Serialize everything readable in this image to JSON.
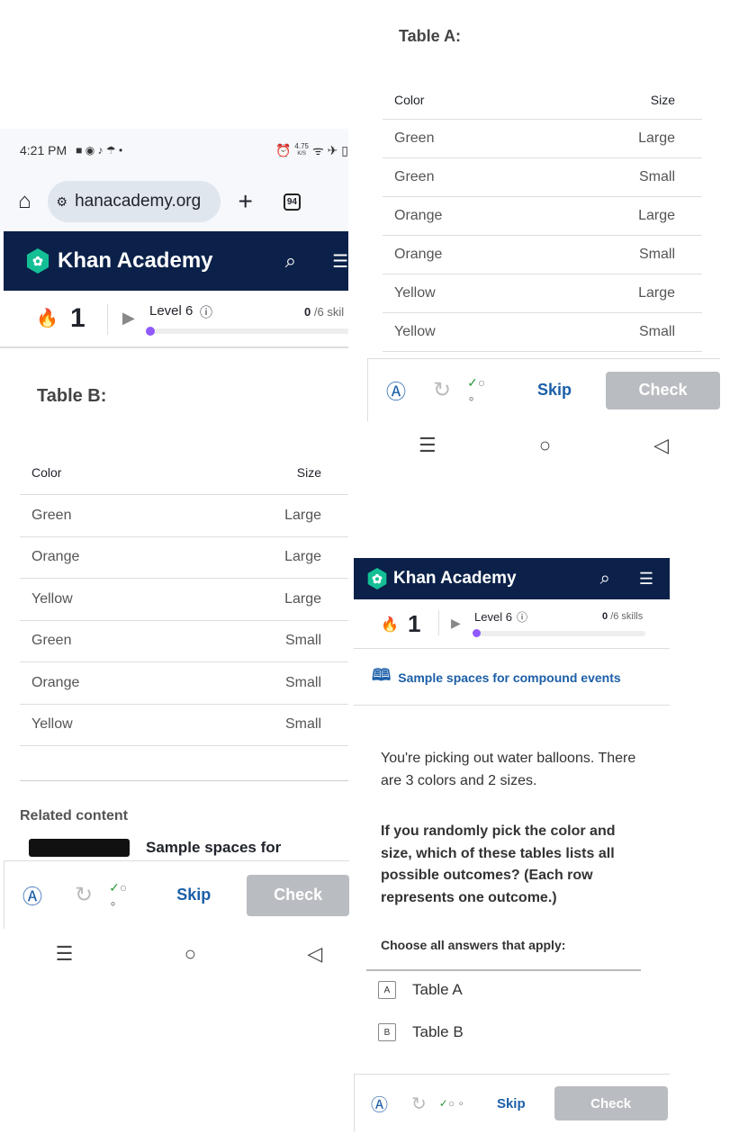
{
  "status_bar": {
    "time": "4:21 PM",
    "net_speed": "4.75",
    "net_unit": "K/S"
  },
  "browser": {
    "url": "hanacademy.org",
    "tab_count": "94"
  },
  "brand": "Khan Academy",
  "streak": "1",
  "level": "Level 6",
  "skills_done": "0",
  "skills_total": "/6 skills",
  "skills_total_cut": "/6 skil",
  "level_progress": 0,
  "table_a": {
    "title": "Table A:",
    "headers": [
      "Color",
      "Size"
    ],
    "rows": [
      [
        "Green",
        "Large"
      ],
      [
        "Green",
        "Small"
      ],
      [
        "Orange",
        "Large"
      ],
      [
        "Orange",
        "Small"
      ],
      [
        "Yellow",
        "Large"
      ],
      [
        "Yellow",
        "Small"
      ]
    ]
  },
  "table_b": {
    "title": "Table B:",
    "headers": [
      "Color",
      "Size"
    ],
    "rows": [
      [
        "Green",
        "Large"
      ],
      [
        "Orange",
        "Large"
      ],
      [
        "Yellow",
        "Large"
      ],
      [
        "Green",
        "Small"
      ],
      [
        "Orange",
        "Small"
      ],
      [
        "Yellow",
        "Small"
      ]
    ]
  },
  "related": {
    "title": "Related content",
    "item": "Sample spaces for"
  },
  "article": "Sample spaces for compound events",
  "question": {
    "p1": "You're picking out water balloons. There are 3 colors and 2 sizes.",
    "p2": "If you randomly pick the color and size, which of these tables lists all possible outcomes? (Each row represents one outcome.)",
    "instruction": "Choose all answers that apply:",
    "choices": [
      {
        "letter": "A",
        "label": "Table A"
      },
      {
        "letter": "B",
        "label": "Table B"
      }
    ]
  },
  "actions": {
    "skip": "Skip",
    "check": "Check"
  },
  "colors": {
    "header": "#0b2149",
    "logo": "#14bf96",
    "accent": "#9059ff",
    "link": "#1c5fa8"
  }
}
